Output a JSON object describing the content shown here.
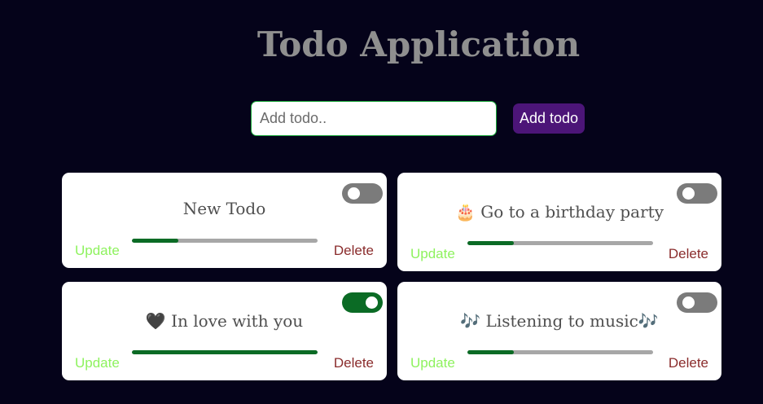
{
  "app": {
    "title": "Todo Application"
  },
  "form": {
    "placeholder": "Add todo..",
    "value": "",
    "add_label": "Add todo"
  },
  "todos": [
    {
      "text": "New Todo",
      "completed": false,
      "progress": 0.25,
      "update_label": "Update",
      "delete_label": "Delete"
    },
    {
      "text": "🎂 Go to a birthday party",
      "completed": false,
      "progress": 0.25,
      "update_label": "Update",
      "delete_label": "Delete"
    },
    {
      "text": "🖤 In love with you",
      "completed": true,
      "progress": 1.0,
      "update_label": "Update",
      "delete_label": "Delete"
    },
    {
      "text": "🎶 Listening to music🎶",
      "completed": false,
      "progress": 0.25,
      "update_label": "Update",
      "delete_label": "Delete"
    }
  ],
  "colors": {
    "background": "#05031a",
    "title": "#8f8f8f",
    "accent": "#4c1578",
    "progress_fill": "#0b6b25",
    "update": "#8ef25e",
    "delete": "#8a2c2c"
  }
}
